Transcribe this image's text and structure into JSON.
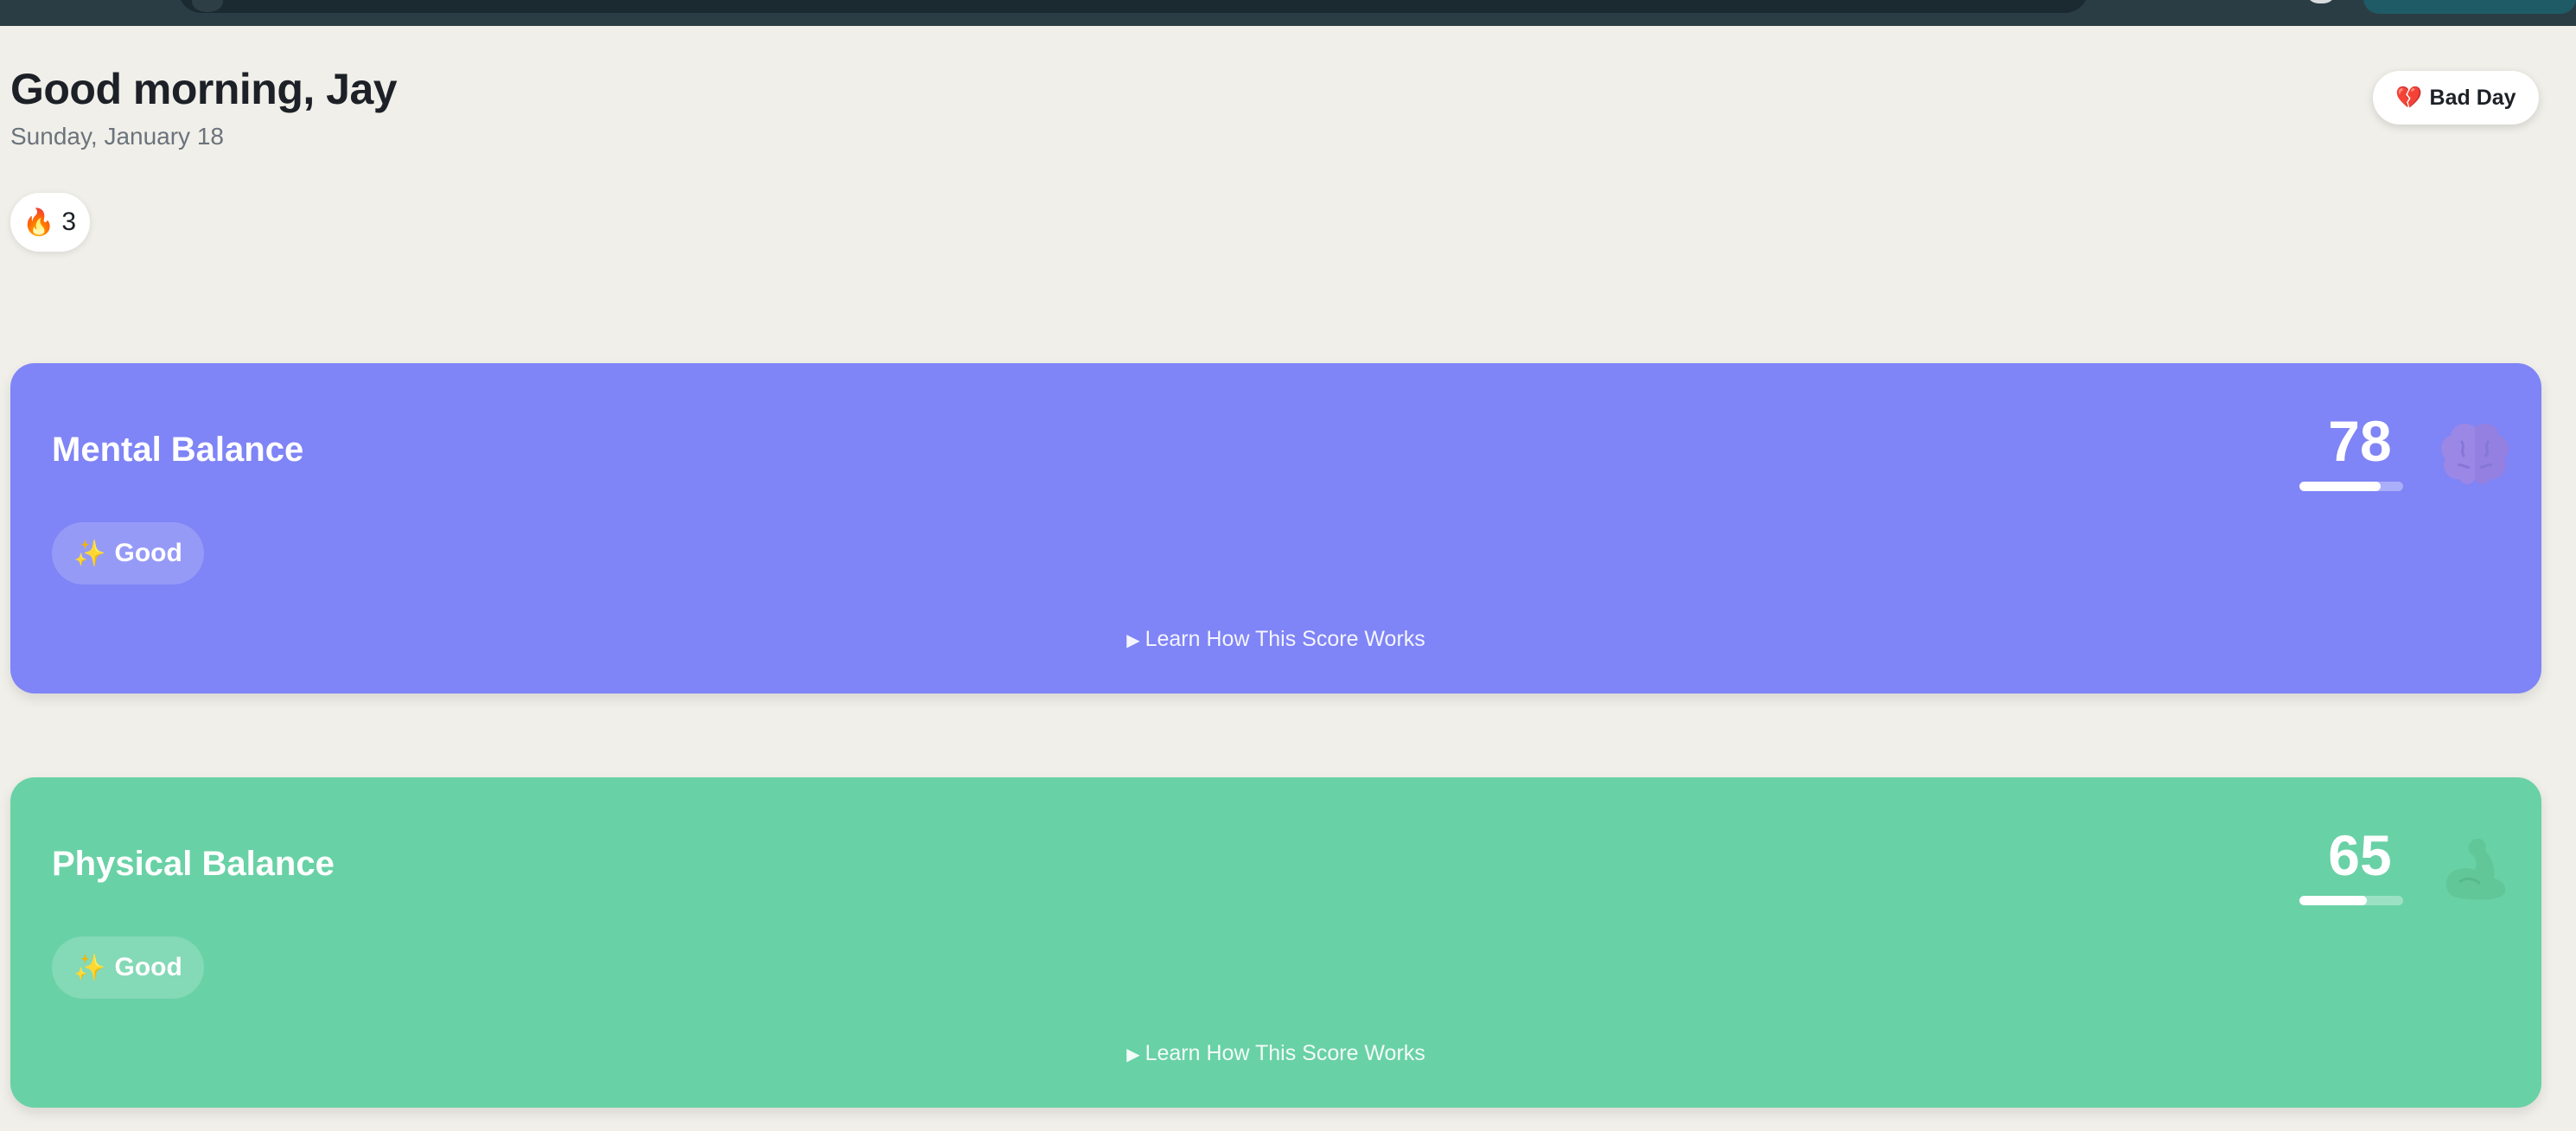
{
  "header": {
    "greeting": "Good morning, Jay",
    "date": "Sunday, January 18",
    "streak_icon": "fire-icon",
    "streak_emoji": "🔥",
    "streak_count": "3",
    "bad_day_icon": "broken-heart-icon",
    "bad_day_emoji": "💔",
    "bad_day_label": "Bad Day"
  },
  "cards": [
    {
      "title": "Mental Balance",
      "rating_emoji": "✨",
      "rating": "Good",
      "score": "78",
      "score_percent": 78,
      "icon": "brain-icon",
      "learn_arrow": "▶",
      "learn_label": "Learn How This Score Works",
      "color": "#7f84f6"
    },
    {
      "title": "Physical Balance",
      "rating_emoji": "✨",
      "rating": "Good",
      "score": "65",
      "score_percent": 65,
      "icon": "flexed-bicep-icon",
      "learn_arrow": "▶",
      "learn_label": "Learn How This Score Works",
      "color": "#69d1a6"
    }
  ]
}
